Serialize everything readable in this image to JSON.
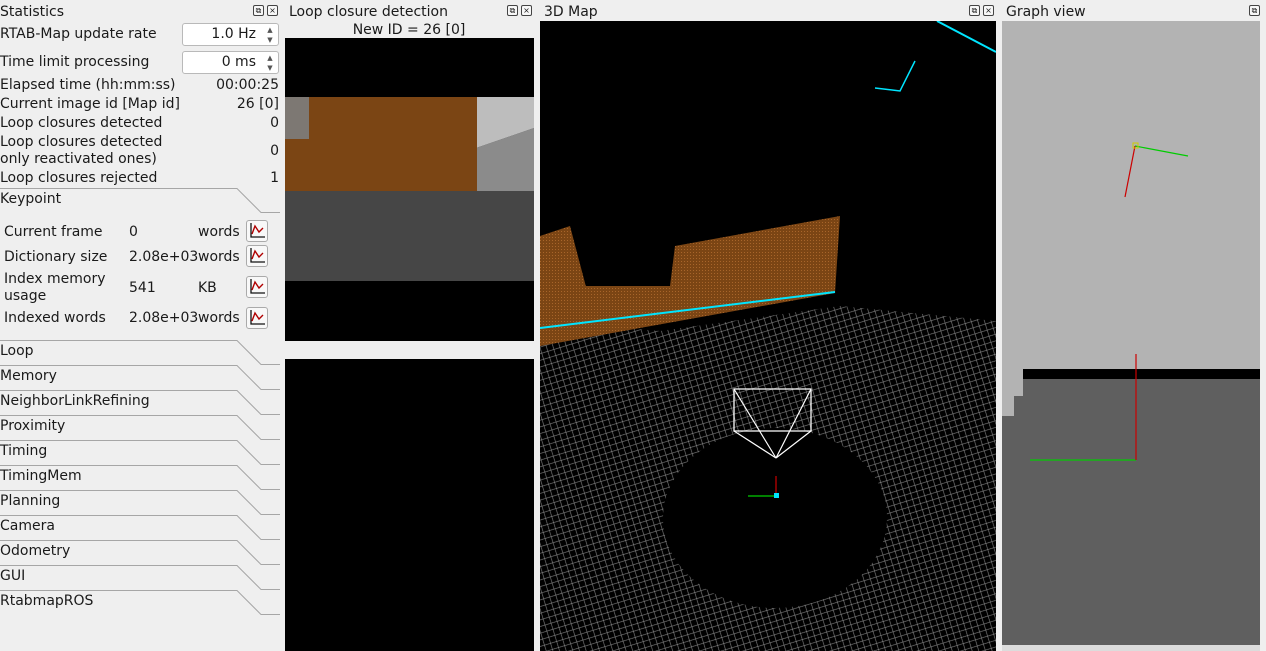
{
  "statistics": {
    "title": "Statistics",
    "update_rate_label": "RTAB-Map update rate",
    "update_rate_value": "1.0 Hz",
    "time_limit_label": "Time limit processing",
    "time_limit_value": "0 ms",
    "elapsed_label": "Elapsed time (hh:mm:ss)",
    "elapsed_value": "00:00:25",
    "current_image_label": "Current image id [Map id]",
    "current_image_value": "26 [0]",
    "loop_detected_label": "Loop closures detected",
    "loop_detected_value": "0",
    "loop_reactivated_label_1": "Loop closures detected",
    "loop_reactivated_label_2": "only reactivated ones)",
    "loop_reactivated_value": "0",
    "loop_rejected_label": "Loop closures rejected",
    "loop_rejected_value": "1",
    "keypoint": {
      "title": "Keypoint",
      "rows": [
        {
          "name": "Current frame",
          "value": "0",
          "unit": "words"
        },
        {
          "name": "Dictionary size",
          "value": "2.08e+03",
          "unit": "words"
        },
        {
          "name_1": "Index memory",
          "name_2": "usage",
          "value": "541",
          "unit": "KB"
        },
        {
          "name": "Indexed words",
          "value": "2.08e+03",
          "unit": "words"
        }
      ]
    },
    "groups": [
      "Loop",
      "Memory",
      "NeighborLinkRefining",
      "Proximity",
      "Timing",
      "TimingMem",
      "Planning",
      "Camera",
      "Odometry",
      "GUI",
      "RtabmapROS"
    ]
  },
  "loop_closure": {
    "title": "Loop closure detection",
    "new_id": "New ID = 26 [0]"
  },
  "map3d": {
    "title": "3D Map"
  },
  "graph": {
    "title": "Graph view"
  },
  "colors": {
    "panel_bg": "#efefef",
    "brown_wall": "#7b4514",
    "cyan_scan": "#00e5ff",
    "grey_floor": "#5f5f5f",
    "graph_free": "#b3b3b3"
  }
}
